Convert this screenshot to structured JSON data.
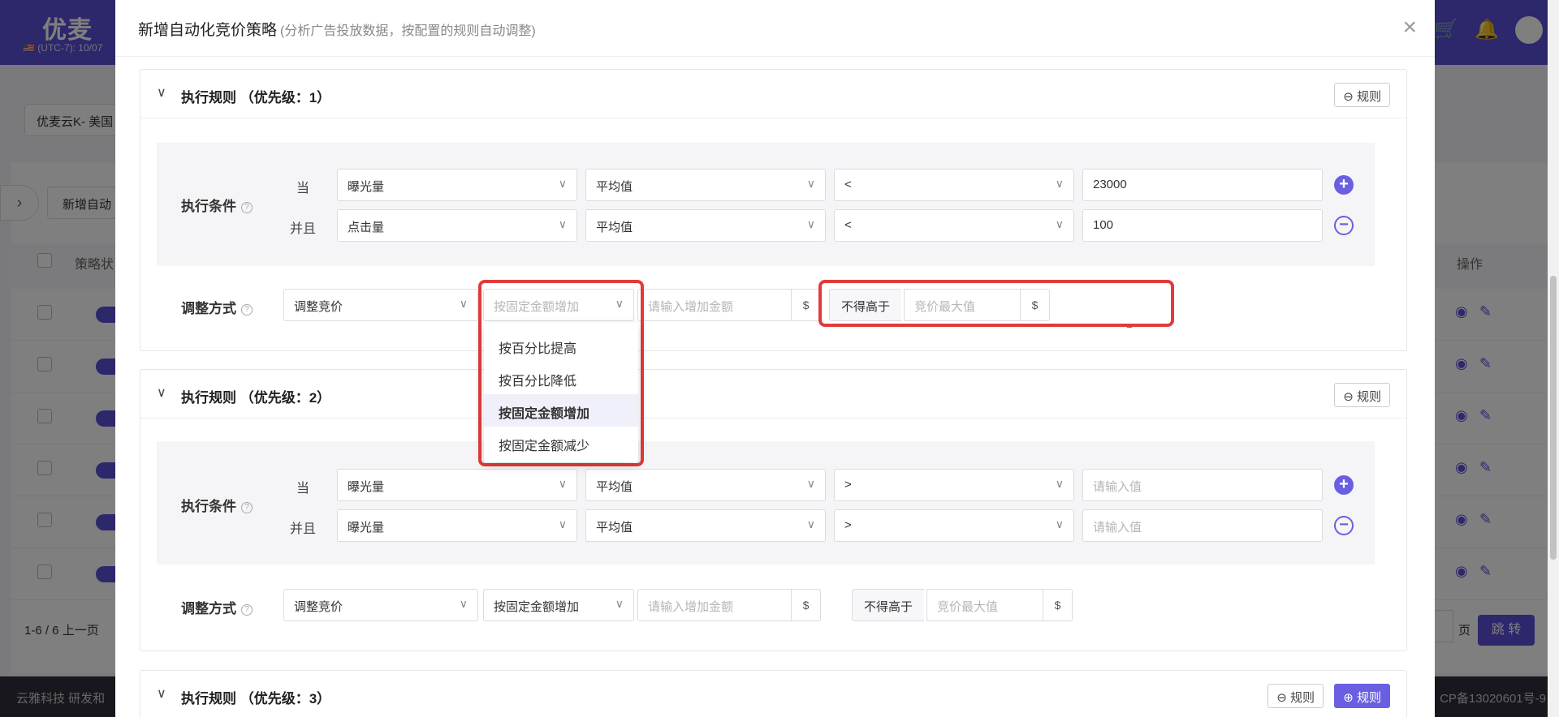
{
  "app": {
    "logo": "优麦",
    "timezone": "🇺🇸 (UTC-7): 10/07",
    "filter_value": "优麦云K- 美国",
    "new_button": "新增自动",
    "col_status": "策略状",
    "col_action": "操作",
    "pager": "1-6 / 6    上一页",
    "page_label": "页",
    "jump_label": "跳 转",
    "footer_left": "云雅科技 研发和",
    "footer_right": "CP备13020601号-9"
  },
  "modal": {
    "title": "新增自动化竞价策略",
    "subtitle": "(分析广告投放数据，按配置的规则自动调整)",
    "close": "×"
  },
  "rules": [
    {
      "title": "执行规则 （优先级：1）",
      "remove_label": "⊖ 规则",
      "condition_label": "执行条件",
      "when_label": "当",
      "and_label": "并且",
      "cond1": {
        "metric": "曝光量",
        "agg": "平均值",
        "op": "<",
        "value": "23000"
      },
      "cond2": {
        "metric": "点击量",
        "agg": "平均值",
        "op": "<",
        "value": "100"
      },
      "adjust_label": "调整方式",
      "adjust_type": "调整竞价",
      "adjust_method": "按固定金额增加",
      "amount_placeholder": "请输入增加金额",
      "currency": "$",
      "limit_prefix": "不得高于",
      "limit_placeholder": "竞价最大值"
    },
    {
      "title": "执行规则 （优先级：2）",
      "remove_label": "⊖ 规则",
      "condition_label": "执行条件",
      "when_label": "当",
      "and_label": "并且",
      "cond1": {
        "metric": "曝光量",
        "agg": "平均值",
        "op": ">",
        "placeholder": "请输入值"
      },
      "cond2": {
        "metric": "曝光量",
        "agg": "平均值",
        "op": ">",
        "placeholder": "请输入值"
      },
      "adjust_label": "调整方式",
      "adjust_type": "调整竞价",
      "adjust_method": "按固定金额增加",
      "amount_placeholder": "请输入增加金额",
      "currency": "$",
      "limit_prefix": "不得高于",
      "limit_placeholder": "竞价最大值"
    },
    {
      "title": "执行规则 （优先级：3）",
      "remove_label": "⊖ 规则",
      "add_label": "⊕ 规则"
    }
  ],
  "dropdown": {
    "options": [
      "按百分比提高",
      "按百分比降低",
      "按固定金额增加",
      "按固定金额减少"
    ],
    "selected": "按固定金额增加"
  },
  "colors": {
    "brand": "#5b4fd6",
    "accent": "#6a5fe0",
    "highlight": "#e23a3a"
  }
}
